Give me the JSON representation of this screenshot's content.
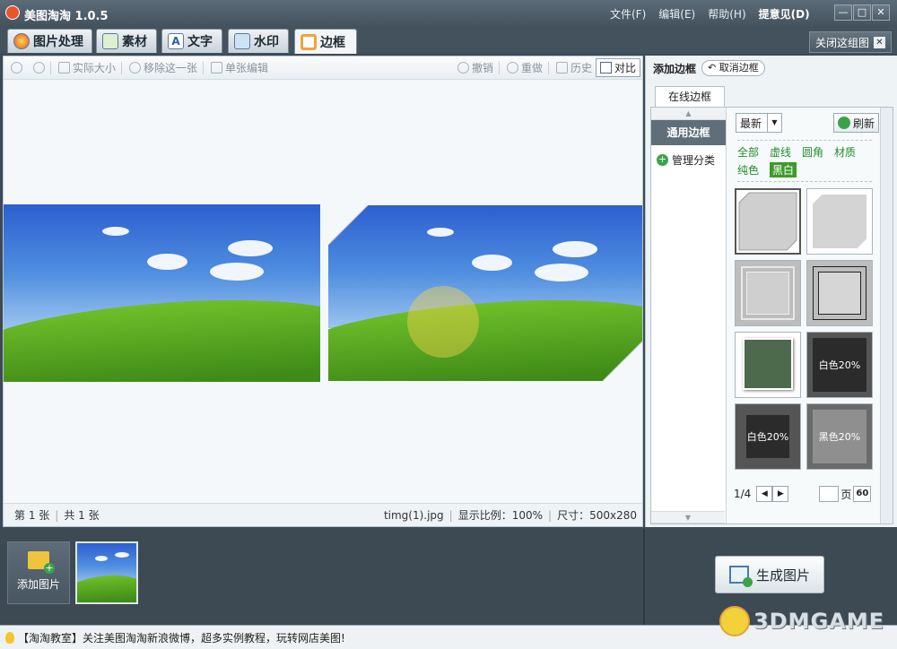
{
  "app": {
    "title": "美图淘淘 1.0.5"
  },
  "menu": {
    "file": "文件(F)",
    "edit": "编辑(E)",
    "help": "帮助(H)",
    "feedback": "提意见(D)"
  },
  "tabs": [
    {
      "label": "图片处理",
      "active": false
    },
    {
      "label": "素材",
      "active": false
    },
    {
      "label": "文字",
      "active": false
    },
    {
      "label": "水印",
      "active": false
    },
    {
      "label": "边框",
      "active": true
    }
  ],
  "close_group": {
    "label": "关闭这组图"
  },
  "toolbar": {
    "actual_size": "实际大小",
    "remove_one": "移除这一张",
    "single_edit": "单张编辑",
    "undo": "撤销",
    "redo": "重做",
    "history": "历史",
    "compare": "对比"
  },
  "status": {
    "current": "第 1 张",
    "total": "共 1 张",
    "filename": "timg(1).jpg",
    "zoom": "显示比例：100%",
    "size": "尺寸：500x280"
  },
  "right_panel": {
    "title": "添加边框",
    "cancel_border": "取消边框",
    "online_tab": "在线边框",
    "category_active": "通用边框",
    "category_manage": "管理分类",
    "sort": "最新",
    "refresh": "刷新",
    "filters": [
      {
        "label": "全部",
        "active": false
      },
      {
        "label": "虚线",
        "active": false
      },
      {
        "label": "圆角",
        "active": false
      },
      {
        "label": "材质",
        "active": false
      },
      {
        "label": "纯色",
        "active": false
      },
      {
        "label": "黑白",
        "active": true
      }
    ],
    "thumb_labels": [
      "白色20%",
      "白色20%",
      "黑色20%"
    ],
    "page_info": "1/4",
    "page_unit": "页",
    "go": "60"
  },
  "bottom": {
    "add_image": "添加图片",
    "generate": "生成图片"
  },
  "news": {
    "text": "【淘淘教室】关注美图淘淘新浪微博，超多实例教程，玩转网店美图!"
  },
  "watermark": {
    "text": "3DMGAME"
  },
  "colors": {
    "accent_green": "#3d9a2c",
    "title_bar": "#44525d"
  }
}
